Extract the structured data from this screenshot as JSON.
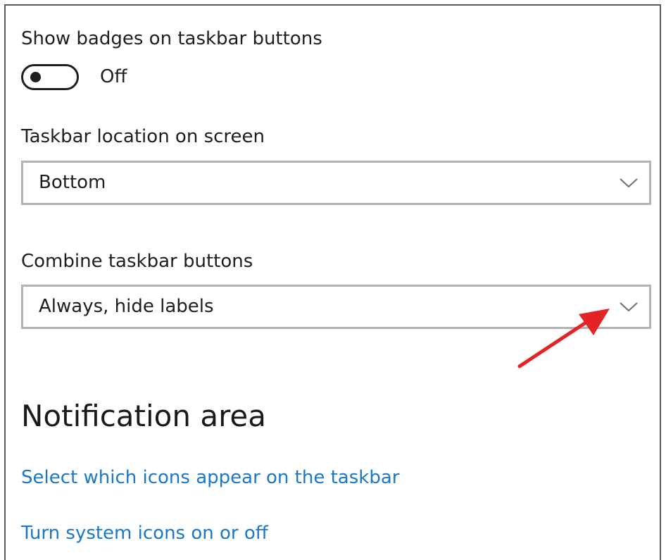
{
  "badges": {
    "label": "Show badges on taskbar buttons",
    "toggle_state": "Off",
    "toggle_on": false
  },
  "location": {
    "label": "Taskbar location on screen",
    "selected": "Bottom"
  },
  "combine": {
    "label": "Combine taskbar buttons",
    "selected": "Always, hide labels"
  },
  "notification": {
    "heading": "Notification area",
    "link_icons": "Select which icons appear on the taskbar",
    "link_system": "Turn system icons on or off"
  },
  "colors": {
    "link": "#1a78c8",
    "annotation_arrow": "#e32326",
    "dropdown_border": "#b3b3b3"
  },
  "icons": {
    "dropdown": "chevron-down-icon",
    "annotation": "red-arrow-annotation"
  }
}
